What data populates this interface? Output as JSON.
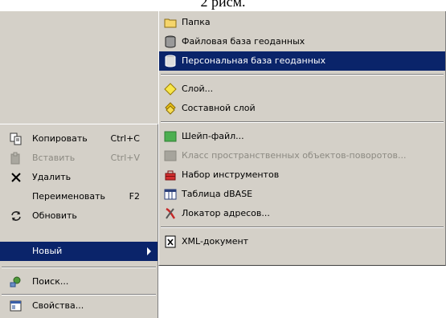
{
  "caption": "2 рисм.",
  "context_menu": {
    "items": [
      {
        "label": "Копировать",
        "shortcut": "Ctrl+C",
        "icon": "copy-icon",
        "state": "normal"
      },
      {
        "label": "Вставить",
        "shortcut": "Ctrl+V",
        "icon": "paste-icon",
        "state": "disabled"
      },
      {
        "label": "Удалить",
        "shortcut": "",
        "icon": "delete-x-icon",
        "state": "normal"
      },
      {
        "label": "Переименовать",
        "shortcut": "F2",
        "icon": "",
        "state": "normal"
      },
      {
        "label": "Обновить",
        "shortcut": "",
        "icon": "refresh-icon",
        "state": "normal"
      },
      {
        "label": "Новый",
        "shortcut": "",
        "icon": "",
        "state": "selected",
        "has_submenu": true
      },
      {
        "label": "Поиск...",
        "shortcut": "",
        "icon": "search-icon",
        "state": "normal"
      },
      {
        "label": "Свойства...",
        "shortcut": "",
        "icon": "properties-icon",
        "state": "normal"
      }
    ]
  },
  "submenu": {
    "items": [
      {
        "label": "Папка",
        "icon": "folder-icon",
        "state": "normal"
      },
      {
        "label": "Файловая база геоданных",
        "icon": "file-geodatabase-icon",
        "state": "normal"
      },
      {
        "label": "Персональная база геоданных",
        "icon": "personal-geodatabase-icon",
        "state": "selected"
      },
      {
        "label": "Слой...",
        "icon": "layer-icon",
        "state": "normal"
      },
      {
        "label": "Составной слой",
        "icon": "group-layer-icon",
        "state": "normal"
      },
      {
        "label": "Шейп-файл...",
        "icon": "shapefile-icon",
        "state": "normal"
      },
      {
        "label": "Класс пространственных объектов-поворотов...",
        "icon": "turn-feature-class-icon",
        "state": "disabled"
      },
      {
        "label": "Набор инструментов",
        "icon": "toolbox-icon",
        "state": "normal"
      },
      {
        "label": "Таблица dBASE",
        "icon": "dbase-table-icon",
        "state": "normal"
      },
      {
        "label": "Локатор адресов...",
        "icon": "address-locator-icon",
        "state": "normal"
      },
      {
        "label": "XML-документ",
        "icon": "xml-document-icon",
        "state": "normal"
      }
    ]
  },
  "colors": {
    "menu_bg": "#d4d0c8",
    "highlight_bg": "#0a246a",
    "highlight_fg": "#ffffff",
    "disabled_fg": "#8c8a82"
  }
}
